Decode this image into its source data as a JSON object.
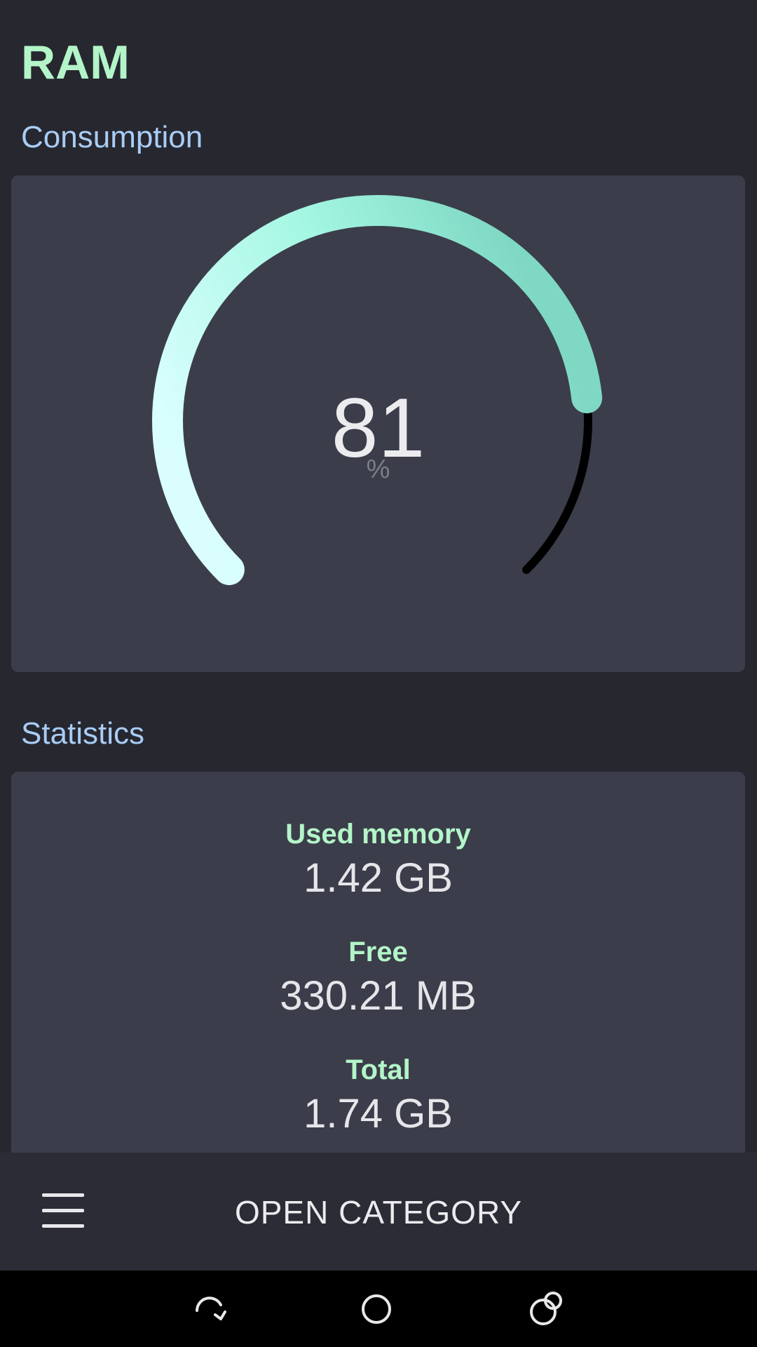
{
  "app": {
    "title": "RAM"
  },
  "consumption": {
    "section_title": "Consumption",
    "gauge": {
      "value": "81",
      "unit": "%",
      "percent": 81,
      "colors": {
        "gradient_start": "#dafefe",
        "gradient_mid": "#a4f7e2",
        "gradient_end": "#7ed8c3",
        "track": "#000000"
      }
    }
  },
  "statistics": {
    "section_title": "Statistics",
    "items": [
      {
        "label": "Used memory",
        "value": "1.42 GB"
      },
      {
        "label": "Free",
        "value": "330.21 MB"
      },
      {
        "label": "Total",
        "value": "1.74 GB"
      }
    ]
  },
  "bottom_bar": {
    "menu_icon": "hamburger-menu-icon",
    "action_label": "OPEN CATEGORY"
  },
  "nav_bar": {
    "icons": [
      "rotate-icon",
      "home-icon",
      "recents-icon"
    ]
  }
}
